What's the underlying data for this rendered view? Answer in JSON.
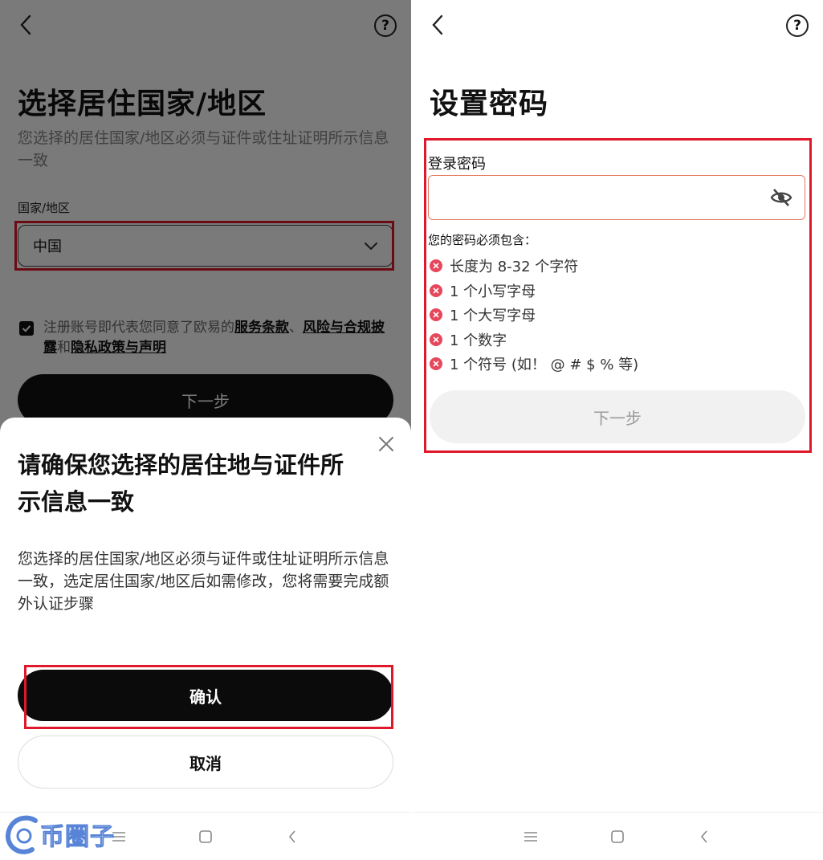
{
  "left_screen": {
    "title": "选择居住国家/地区",
    "subtitle": "您选择的居住国家/地区必须与证件或住址证明所示信息一致",
    "country_field": {
      "label": "国家/地区",
      "value": "中国"
    },
    "agreement": {
      "prefix": "注册账号即代表您同意了欧易的",
      "link_terms": "服务条款",
      "sep1": "、",
      "link_risk": "风险与合规披露",
      "sep2": "和",
      "link_privacy": "隐私政策与声明",
      "checked": true
    },
    "next_button": "下一步",
    "sheet": {
      "title": "请确保您选择的居住地与证件所示信息一致",
      "body": "您选择的居住国家/地区必须与证件或住址证明所示信息一致，选定居住国家/地区后如需修改，您将需要完成额外认证步骤",
      "confirm_button": "确认",
      "cancel_button": "取消"
    },
    "watermark": "币圈子"
  },
  "right_screen": {
    "title": "设置密码",
    "password_field": {
      "label": "登录密码",
      "value": "",
      "placeholder": ""
    },
    "requirements_title": "您的密码必须包含：",
    "requirements": [
      "长度为 8-32 个字符",
      "1 个小写字母",
      "1 个大写字母",
      "1 个数字",
      "1 个符号 (如！ @ # $ % 等)"
    ],
    "next_button": "下一步"
  },
  "colors": {
    "highlight_frame": "#e0182b",
    "primary_button": "#0b0b0b",
    "error_dot": "#e6475b",
    "disabled_button": "#f1f1f1"
  },
  "icons": [
    "back-arrow-icon",
    "help-icon",
    "chevron-down-icon",
    "check-icon",
    "close-icon",
    "eye-off-icon",
    "error-x-icon",
    "menu-icon",
    "home-square-icon",
    "nav-back-icon"
  ]
}
